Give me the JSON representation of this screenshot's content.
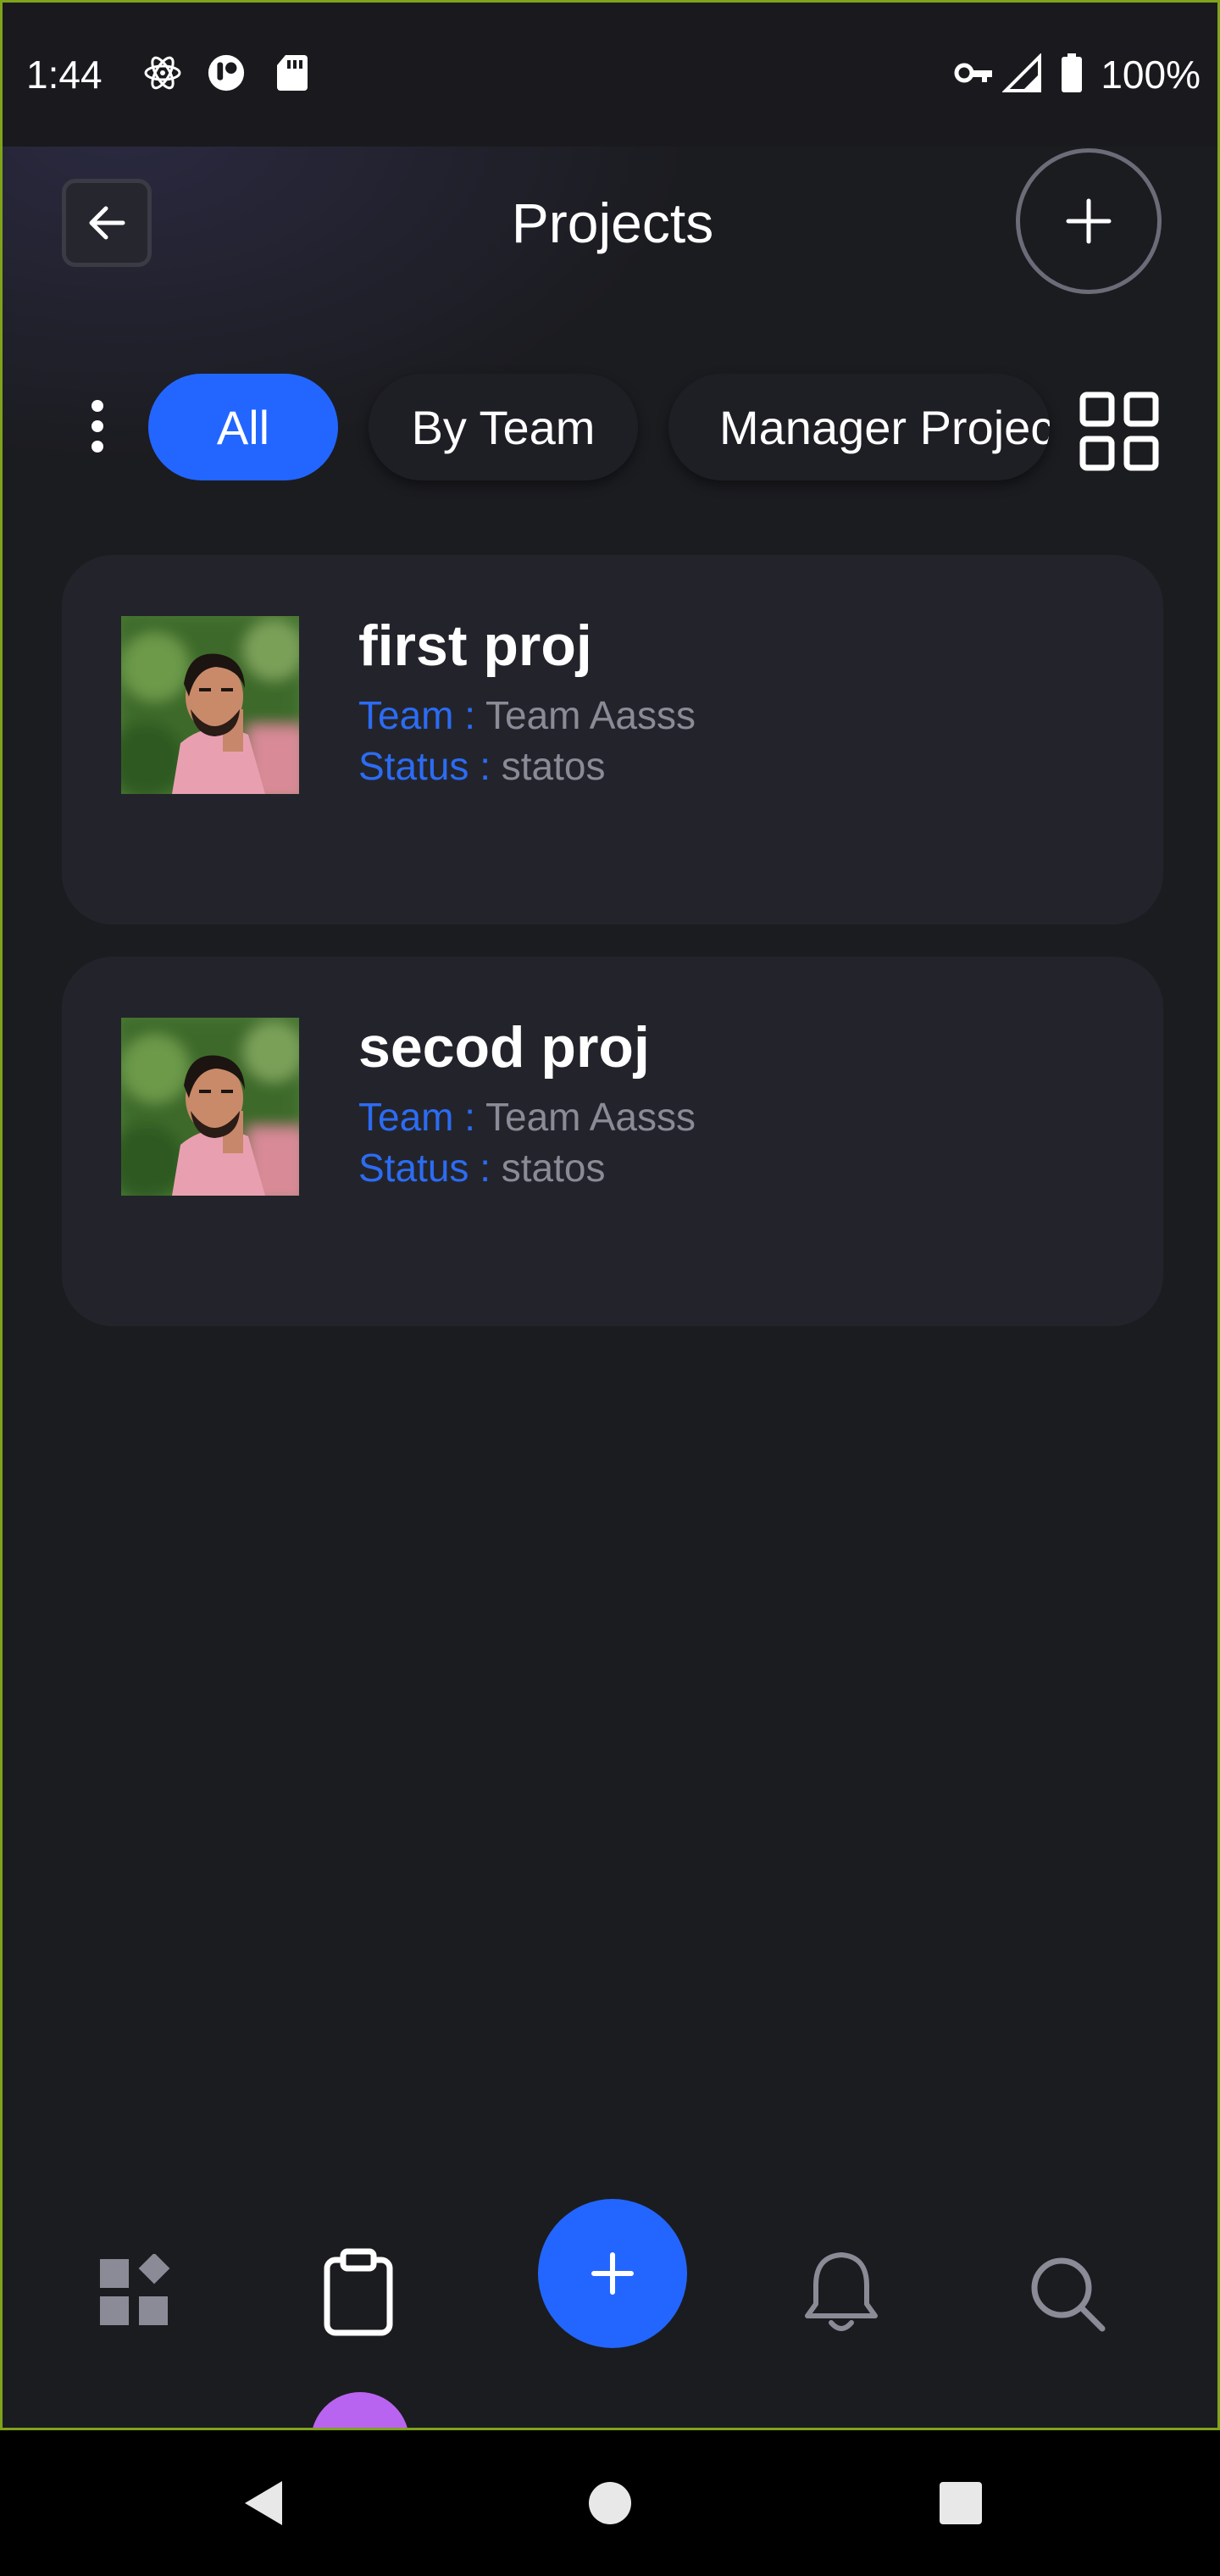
{
  "status_bar": {
    "time": "1:44",
    "battery": "100%",
    "icons": [
      "atom-icon",
      "tracker-icon",
      "sd-card-icon",
      "vpn-key-icon",
      "signal-icon",
      "battery-icon"
    ]
  },
  "header": {
    "title": "Projects",
    "back_icon": "arrow-left-icon",
    "add_icon": "plus-icon"
  },
  "filters": {
    "chips": [
      {
        "label": "All",
        "active": true
      },
      {
        "label": "By Team",
        "active": false
      },
      {
        "label": "Manager Projec",
        "active": false
      }
    ],
    "more_icon": "more-vertical-icon",
    "view_icon": "grid-view-icon"
  },
  "projects": [
    {
      "name": "first proj",
      "team_label": "Team :",
      "team": "Team Aasss",
      "status_label": "Status :",
      "status": "statos"
    },
    {
      "name": "secod proj",
      "team_label": "Team :",
      "team": "Team Aasss",
      "status_label": "Status :",
      "status": "statos"
    }
  ],
  "bottom_nav": {
    "items": [
      "dashboard-icon",
      "clipboard-icon",
      "plus-icon",
      "bell-icon",
      "search-icon"
    ],
    "active": "clipboard-icon"
  },
  "colors": {
    "accent": "#2366ff",
    "background": "#1b1c20",
    "card": "#23242b",
    "meta_key": "#2c6cf4",
    "meta_value": "#8a8b96",
    "indicator": "#b964f0"
  }
}
